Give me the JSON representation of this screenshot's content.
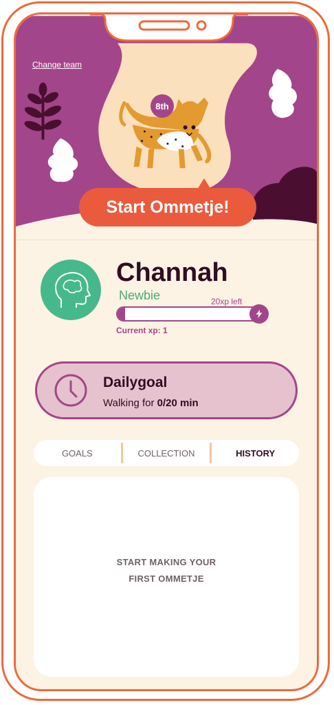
{
  "header": {
    "change_team_label": "Change team",
    "rank": "8th",
    "start_button_label": "Start Ommetje!"
  },
  "profile": {
    "name": "Channah",
    "level": "Newbie",
    "xp_left": "20xp left",
    "xp_progress": 0.05,
    "current_xp": "Current xp: 1"
  },
  "daily_goal": {
    "title": "Dailygoal",
    "subtitle_prefix": "Walking for ",
    "subtitle_value": "0/20 min"
  },
  "tabs": [
    {
      "label": "GOALS"
    },
    {
      "label": "COLLECTION"
    },
    {
      "label": "HISTORY",
      "active": true
    }
  ],
  "history": {
    "empty_line1": "START MAKING YOUR",
    "empty_line2": "FIRST OMMETJE"
  },
  "colors": {
    "accent": "#ec6a3a",
    "purple": "#a3458a",
    "green": "#46b98c",
    "cream": "#fcf3e4",
    "dark": "#2f0d23"
  }
}
